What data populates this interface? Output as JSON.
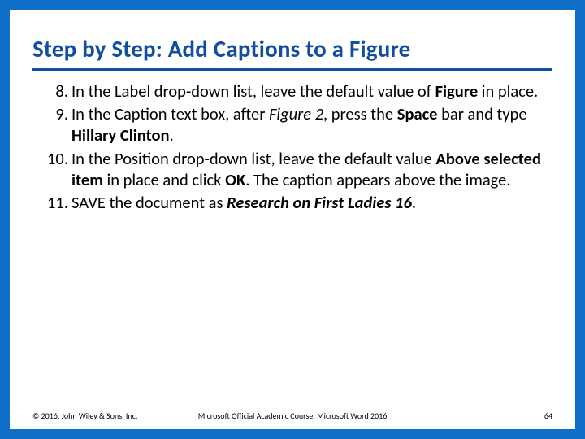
{
  "slide": {
    "title": "Step by Step: Add Captions to a Figure",
    "steps": [
      {
        "pre": "In the Label drop-down list, leave the default value of ",
        "bold1": "Figure",
        "post1": " in place."
      },
      {
        "pre": "In the Caption text box, after ",
        "ital": "Figure 2",
        "mid": ", press the ",
        "bold1": "Space",
        "mid2": " bar and type ",
        "bold2": "Hillary Clinton",
        "post": "."
      },
      {
        "pre": "In the Position drop-down list, leave the default value ",
        "bold1": "Above selected item",
        "mid": " in place and click ",
        "bold2": "OK",
        "post": ". The caption appears above the image."
      },
      {
        "pre": "SAVE the document as ",
        "bi": "Research on First Ladies 16",
        "post": "."
      }
    ],
    "footer": {
      "left": "© 2016, John Wiley & Sons, Inc.",
      "center": "Microsoft Official Academic Course, Microsoft Word 2016",
      "right": "64"
    }
  }
}
